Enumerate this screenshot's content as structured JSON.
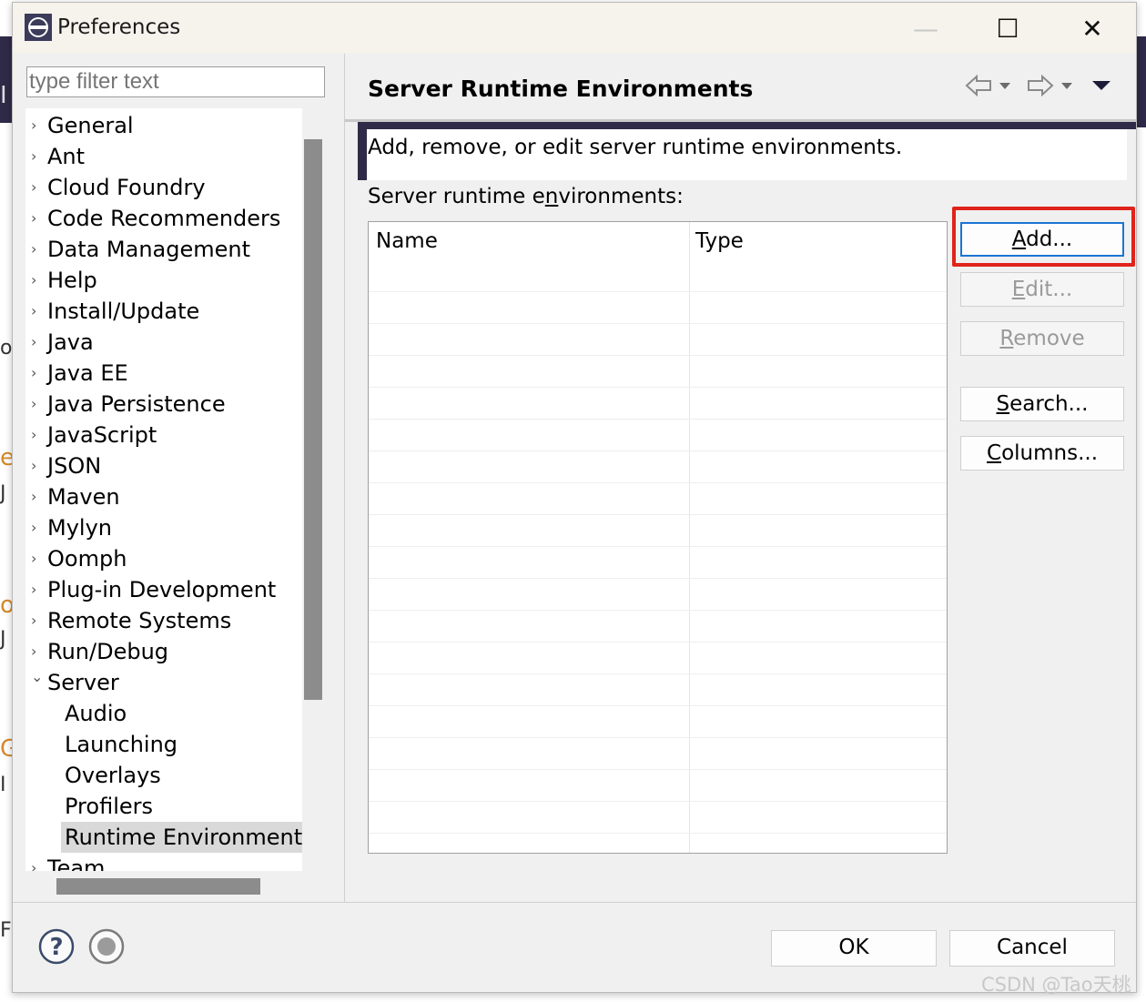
{
  "window": {
    "title": "Preferences",
    "minimize_glyph": "—",
    "maximize_glyph": "☐",
    "close_glyph": "✕"
  },
  "filter": {
    "placeholder": "type filter text"
  },
  "tree": {
    "items": [
      {
        "label": "General",
        "expanded": false
      },
      {
        "label": "Ant",
        "expanded": false
      },
      {
        "label": "Cloud Foundry",
        "expanded": false
      },
      {
        "label": "Code Recommenders",
        "expanded": false
      },
      {
        "label": "Data Management",
        "expanded": false
      },
      {
        "label": "Help",
        "expanded": false
      },
      {
        "label": "Install/Update",
        "expanded": false
      },
      {
        "label": "Java",
        "expanded": false
      },
      {
        "label": "Java EE",
        "expanded": false
      },
      {
        "label": "Java Persistence",
        "expanded": false
      },
      {
        "label": "JavaScript",
        "expanded": false
      },
      {
        "label": "JSON",
        "expanded": false
      },
      {
        "label": "Maven",
        "expanded": false
      },
      {
        "label": "Mylyn",
        "expanded": false
      },
      {
        "label": "Oomph",
        "expanded": false
      },
      {
        "label": "Plug-in Development",
        "expanded": false
      },
      {
        "label": "Remote Systems",
        "expanded": false
      },
      {
        "label": "Run/Debug",
        "expanded": false
      },
      {
        "label": "Server",
        "expanded": true
      },
      {
        "label": "Audio",
        "child": true
      },
      {
        "label": "Launching",
        "child": true
      },
      {
        "label": "Overlays",
        "child": true
      },
      {
        "label": "Profilers",
        "child": true
      },
      {
        "label": "Runtime Environments",
        "child": true,
        "selected": true
      },
      {
        "label": "Team",
        "expanded": false
      }
    ]
  },
  "page": {
    "title": "Server Runtime Environments",
    "description": "Add, remove, or edit server runtime environments.",
    "section_label_before": "Server runtime e",
    "section_label_mnemonic": "n",
    "section_label_after": "vironments:"
  },
  "table": {
    "columns": [
      "Name",
      "Type"
    ],
    "rows": []
  },
  "buttons": {
    "add": {
      "mnemonic": "A",
      "rest": "dd..."
    },
    "edit": {
      "mnemonic": "E",
      "rest": "dit..."
    },
    "remove": {
      "mnemonic": "R",
      "rest": "emove"
    },
    "search": {
      "mnemonic": "S",
      "rest": "earch..."
    },
    "columns": {
      "mnemonic": "C",
      "rest": "olumns..."
    }
  },
  "footer": {
    "ok": "OK",
    "cancel": "Cancel"
  },
  "watermark": "CSDN @Tao天桃",
  "background_fragments": [
    "I",
    "o",
    "e",
    "J",
    "o",
    "J",
    "G",
    "I",
    "Fr"
  ],
  "colors": {
    "accent_band": "#2f2a47",
    "highlight_box": "#e0231b",
    "focus_border": "#1b74d4"
  }
}
